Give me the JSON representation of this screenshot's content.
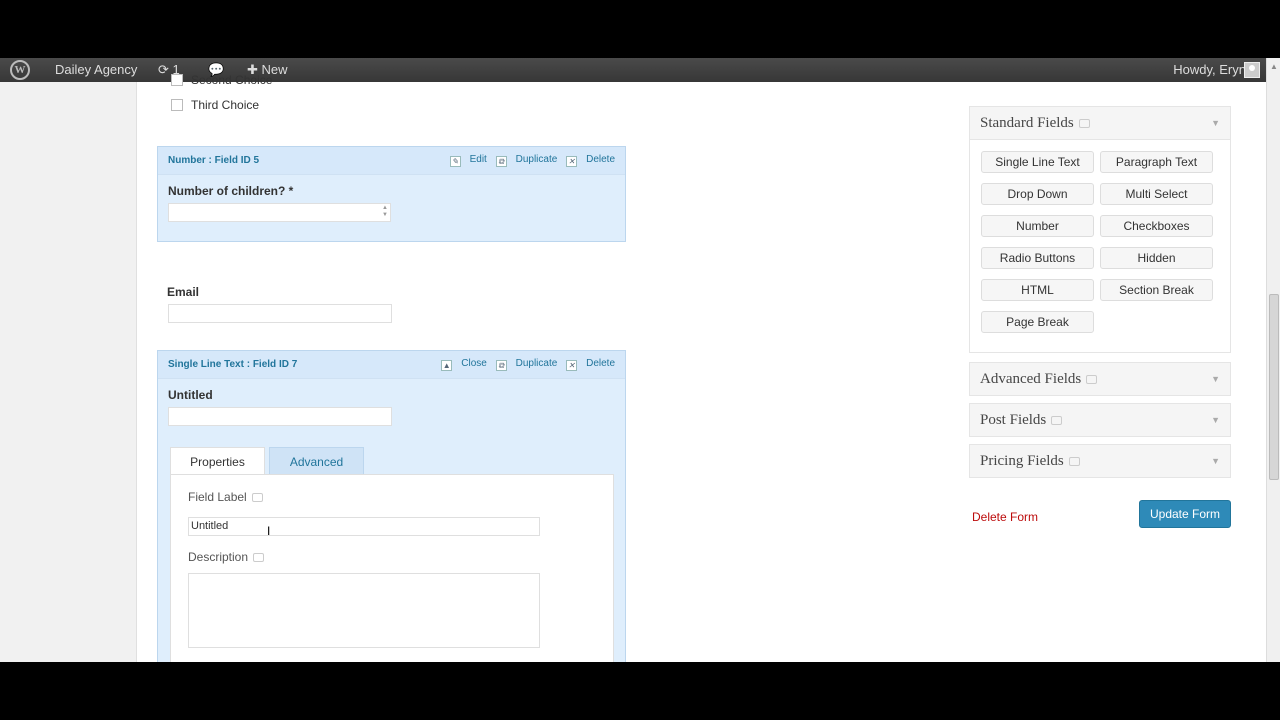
{
  "adminbar": {
    "logo": "W",
    "site_name": "Dailey Agency",
    "updates_count": "1",
    "new_label": "New",
    "howdy": "Howdy, Eryn",
    "icons": [
      "wordpress-icon",
      "refresh-icon",
      "comment-icon",
      "plus-icon",
      "avatar"
    ]
  },
  "form": {
    "choices": [
      {
        "label": "Second Choice"
      },
      {
        "label": "Third Choice"
      }
    ],
    "number_field": {
      "title": "Number : Field ID 5",
      "edit": "Edit",
      "duplicate": "Duplicate",
      "delete": "Delete",
      "label": "Number of children? *"
    },
    "email_label": "Email",
    "text_field": {
      "title": "Single Line Text : Field ID 7",
      "close": "Close",
      "duplicate": "Duplicate",
      "delete": "Delete",
      "label": "Untitled",
      "tabs": [
        "Properties",
        "Advanced"
      ],
      "field_label_caption": "Field Label",
      "field_label_value": "Untitled",
      "description_caption": "Description"
    }
  },
  "sidebar": {
    "standard": {
      "title": "Standard Fields",
      "buttons": [
        "Single Line Text",
        "Paragraph Text",
        "Drop Down",
        "Multi Select",
        "Number",
        "Checkboxes",
        "Radio Buttons",
        "Hidden",
        "HTML",
        "Section Break",
        "Page Break"
      ]
    },
    "advanced_title": "Advanced Fields",
    "post_title": "Post Fields",
    "pricing_title": "Pricing Fields",
    "delete_form": "Delete Form",
    "update_form": "Update Form"
  }
}
